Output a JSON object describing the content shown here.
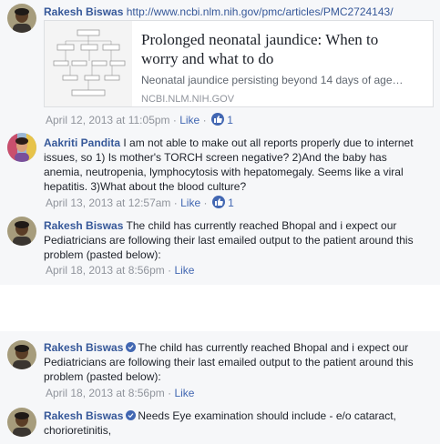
{
  "thread1": {
    "comment1": {
      "author": "Rakesh Biswas",
      "link": "http://www.ncbi.nlm.nih.gov/pmc/articles/PMC2724143/",
      "preview": {
        "title_line1": "Prolonged neonatal jaundice: When to",
        "title_line2": "worry and what to do",
        "description": "Neonatal jaundice persisting beyond 14 days of age…",
        "site": "NCBI.NLM.NIH.GOV"
      },
      "timestamp": "April 12, 2013 at 11:05pm",
      "like_label": "Like",
      "like_count": "1"
    },
    "comment2": {
      "author": "Aakriti Pandita",
      "text_line1": "I am not able to make out all reports properly due to internet",
      "text_line2": "issues, so 1) Is mother's TORCH screen negative? 2)And the baby has",
      "text_line3": "anemia, neutropenia, lymphocytosis with hepatomegaly. Seems like a viral",
      "text_line4": "hepatitis. 3)What about the blood culture?",
      "timestamp": "April 13, 2013 at 12:57am",
      "like_label": "Like",
      "like_count": "1"
    },
    "comment3": {
      "author": "Rakesh Biswas",
      "text_line1": "The child has currently reached Bhopal and i expect our",
      "text_line2": "Pediatricians are following their last emailed output to the patient around this",
      "text_line3": "problem (pasted below):",
      "timestamp": "April 18, 2013 at 8:56pm",
      "like_label": "Like"
    }
  },
  "thread2": {
    "comment1": {
      "author": "Rakesh Biswas",
      "text_line1": "The child has currently reached Bhopal and i expect our",
      "text_line2": "Pediatricians are following their last emailed output to the patient around this",
      "text_line3": "problem (pasted below):",
      "timestamp": "April 18, 2013 at 8:56pm",
      "like_label": "Like"
    },
    "comment2": {
      "author": "Rakesh Biswas",
      "text_line1": "Needs Eye examination should include - e/o cataract,",
      "text_line2": "chorioretinitis,"
    }
  },
  "separator": " · ",
  "colors": {
    "author": "#365899",
    "meta": "#90949c",
    "like_blue": "#4267b2",
    "panel_bg": "#f6f7f9"
  },
  "icons": [
    "avatar-rakesh",
    "avatar-aakriti",
    "like-thumb-icon",
    "verified-badge-icon"
  ]
}
